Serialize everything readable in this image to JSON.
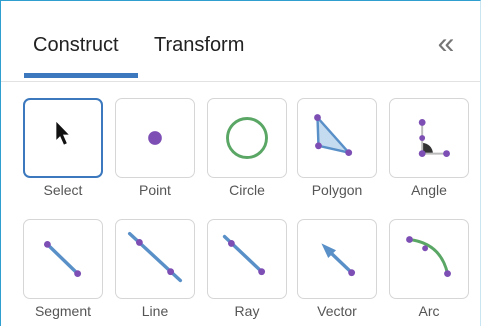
{
  "tabs": {
    "construct": "Construct",
    "transform": "Transform",
    "collapse_glyph": "«"
  },
  "tools": [
    {
      "id": "select",
      "label": "Select",
      "icon": "arrow-cursor-icon",
      "selected": true
    },
    {
      "id": "point",
      "label": "Point",
      "icon": "point-icon"
    },
    {
      "id": "circle",
      "label": "Circle",
      "icon": "circle-icon"
    },
    {
      "id": "polygon",
      "label": "Polygon",
      "icon": "polygon-icon"
    },
    {
      "id": "angle",
      "label": "Angle",
      "icon": "angle-icon"
    },
    {
      "id": "segment",
      "label": "Segment",
      "icon": "segment-icon"
    },
    {
      "id": "line",
      "label": "Line",
      "icon": "line-icon"
    },
    {
      "id": "ray",
      "label": "Ray",
      "icon": "ray-icon"
    },
    {
      "id": "vector",
      "label": "Vector",
      "icon": "vector-icon"
    },
    {
      "id": "arc",
      "label": "Arc",
      "icon": "arc-icon"
    }
  ],
  "colors": {
    "accent": "#3b78bd",
    "point_purple": "#7d4fb5",
    "green": "#5aa765",
    "line_blue": "#5a90c8",
    "fill_blue": "#c5dcf0"
  }
}
